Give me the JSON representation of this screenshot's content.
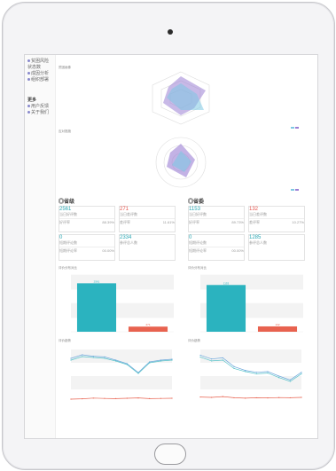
{
  "sidebar": {
    "items": [
      {
        "label": "贫困风险"
      },
      {
        "label": "状态数"
      },
      {
        "label": "成因分析"
      },
      {
        "label": "组织部署"
      }
    ],
    "more_label": "更多",
    "more_items": [
      {
        "label": "用户反馈"
      },
      {
        "label": "关于我们"
      }
    ]
  },
  "radar": {
    "top_title": "贫困画像",
    "bottom_title": "应对措施",
    "legend": "",
    "colors": {
      "series_a": "#7ec8e3",
      "series_b": "#9b7fd4"
    }
  },
  "panels": [
    {
      "title": "◎省级",
      "cards": [
        {
          "value": "2561",
          "label": "当日好评数",
          "sub_label": "好评率",
          "sub_value": "88.39%"
        },
        {
          "value": "271",
          "label": "当日差评数",
          "sub_label": "差评率",
          "sub_value": "11.61%",
          "red": true
        },
        {
          "value": "0",
          "label": "短期评论数",
          "sub_label": "短期评论率",
          "sub_value": "00.00%"
        },
        {
          "value": "2334",
          "label": "参评总人数",
          "sub_label": "",
          "sub_value": ""
        }
      ],
      "bar_title": "评价分布对比",
      "line_title": "评价趋势"
    },
    {
      "title": "◎省委",
      "cards": [
        {
          "value": "1153",
          "label": "当日好评数",
          "sub_label": "好评率",
          "sub_value": "89.73%"
        },
        {
          "value": "132",
          "label": "当日差评数",
          "sub_label": "差评率",
          "sub_value": "10.27%",
          "red": true
        },
        {
          "value": "0",
          "label": "短期评论数",
          "sub_label": "短期评论率",
          "sub_value": "00.00%"
        },
        {
          "value": "1285",
          "label": "参评总人数",
          "sub_label": "",
          "sub_value": ""
        }
      ],
      "bar_title": "评价分布对比",
      "line_title": "评价趋势"
    }
  ],
  "chart_data": [
    {
      "type": "bar",
      "categories": [
        "好评",
        "差评"
      ],
      "values": [
        2561,
        271
      ],
      "colors": [
        "#2bb3bf",
        "#e8624f"
      ],
      "ylim": [
        0,
        3000
      ]
    },
    {
      "type": "bar",
      "categories": [
        "好评",
        "差评"
      ],
      "values": [
        1153,
        132
      ],
      "colors": [
        "#2bb3bf",
        "#e8624f"
      ],
      "ylim": [
        0,
        1400
      ]
    },
    {
      "type": "line",
      "x": [
        1,
        2,
        3,
        4,
        5,
        6,
        7,
        8,
        9,
        10
      ],
      "series": [
        {
          "values": [
            2500,
            2700,
            2620,
            2580,
            2400,
            2200,
            1700,
            2300,
            2400,
            2450
          ],
          "color": "#6fa8dc"
        },
        {
          "values": [
            2400,
            2600,
            2550,
            2500,
            2350,
            2150,
            1650,
            2250,
            2350,
            2400
          ],
          "color": "#56c2c9"
        },
        {
          "values": [
            200,
            220,
            260,
            240,
            230,
            250,
            270,
            230,
            240,
            250
          ],
          "color": "#e8624f"
        }
      ],
      "ylim": [
        0,
        3000
      ]
    },
    {
      "type": "line",
      "x": [
        1,
        2,
        3,
        4,
        5,
        6,
        7,
        8,
        9,
        10
      ],
      "series": [
        {
          "values": [
            1250,
            1150,
            1180,
            950,
            850,
            800,
            820,
            700,
            600,
            800
          ],
          "color": "#6fa8dc"
        },
        {
          "values": [
            1200,
            1100,
            1120,
            900,
            820,
            760,
            780,
            660,
            560,
            760
          ],
          "color": "#56c2c9"
        },
        {
          "values": [
            150,
            140,
            160,
            130,
            120,
            130,
            125,
            135,
            130,
            140
          ],
          "color": "#e8624f"
        }
      ],
      "ylim": [
        0,
        1400
      ]
    }
  ]
}
